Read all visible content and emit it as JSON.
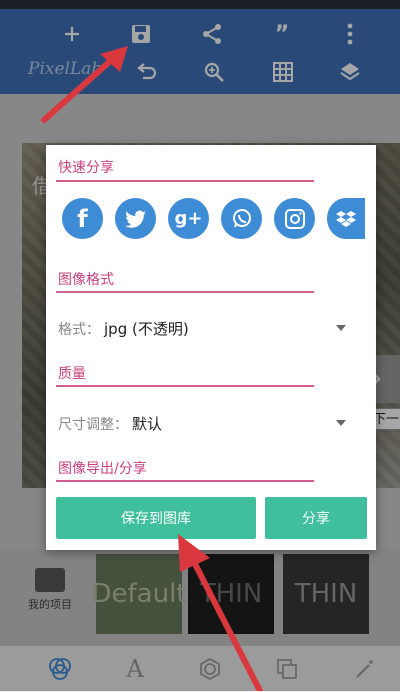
{
  "app": {
    "logo_text": "PixelLab"
  },
  "icons": {
    "top_row": [
      "plus-icon",
      "save-icon",
      "share-icon",
      "quote-icon",
      "more-vert-icon"
    ],
    "second_row": [
      "undo-icon",
      "zoom-in-icon",
      "grid-icon",
      "layers-icon"
    ]
  },
  "canvas": {
    "partial_text": "借"
  },
  "dialog": {
    "quick_share_title": "快速分享",
    "share_targets": [
      "f",
      "twitter",
      "g+",
      "whatsapp",
      "instagram",
      "dropbox"
    ],
    "share_glyphs": {
      "facebook": "f",
      "googleplus": "g+"
    },
    "image_format_title": "图像格式",
    "format_label": "格式：",
    "format_value": "jpg (不透明)",
    "quality_title": "质量",
    "resize_label": "尺寸调整：",
    "resize_value": "默认",
    "export_title": "图像导出/分享",
    "save_button": "保存到图库",
    "share_button": "分享"
  },
  "next_tooltip": "下一",
  "bottom": {
    "my_projects_label": "我的项目",
    "thumbs": [
      "Default",
      "THIN",
      "THIN"
    ]
  },
  "colors": {
    "appbar": "#3f72b9",
    "section_accent": "#c9427f",
    "share_icon_bg": "#3e8bd6",
    "button": "#3fbf9c",
    "arrow": "#d9383f"
  }
}
